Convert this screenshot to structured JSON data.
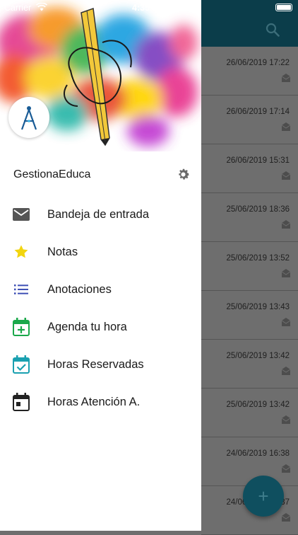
{
  "status_bar": {
    "carrier": "Carrier",
    "time": "4:35 PM"
  },
  "app": {
    "name": "GestionaEduca"
  },
  "menu": [
    {
      "label": "Bandeja de entrada",
      "icon": "mail-icon"
    },
    {
      "label": "Notas",
      "icon": "star-icon"
    },
    {
      "label": "Anotaciones",
      "icon": "list-icon"
    },
    {
      "label": "Agenda tu hora",
      "icon": "calendar-add-icon"
    },
    {
      "label": "Horas Reservadas",
      "icon": "calendar-check-icon"
    },
    {
      "label": "Horas Atención A.",
      "icon": "calendar-icon"
    }
  ],
  "messages": [
    {
      "date": "26/06/2019 17:22"
    },
    {
      "date": "26/06/2019 17:14"
    },
    {
      "date": "26/06/2019 15:31"
    },
    {
      "date": "25/06/2019 18:36"
    },
    {
      "date": "25/06/2019 13:52"
    },
    {
      "date": "25/06/2019 13:43"
    },
    {
      "date": "25/06/2019 13:42"
    },
    {
      "date": "25/06/2019 13:42"
    },
    {
      "date": "24/06/2019 16:38"
    },
    {
      "date": "24/06/2019 16:37"
    }
  ],
  "colors": {
    "header": "#0b3d4a",
    "fab": "#0f4f5f",
    "mail_icon": "#555555",
    "star_icon": "#f2d50f",
    "list_icon": "#3f51b5",
    "calendar_add_icon": "#1aa84a",
    "calendar_check_icon": "#1aa0b0",
    "calendar_icon": "#222222"
  }
}
